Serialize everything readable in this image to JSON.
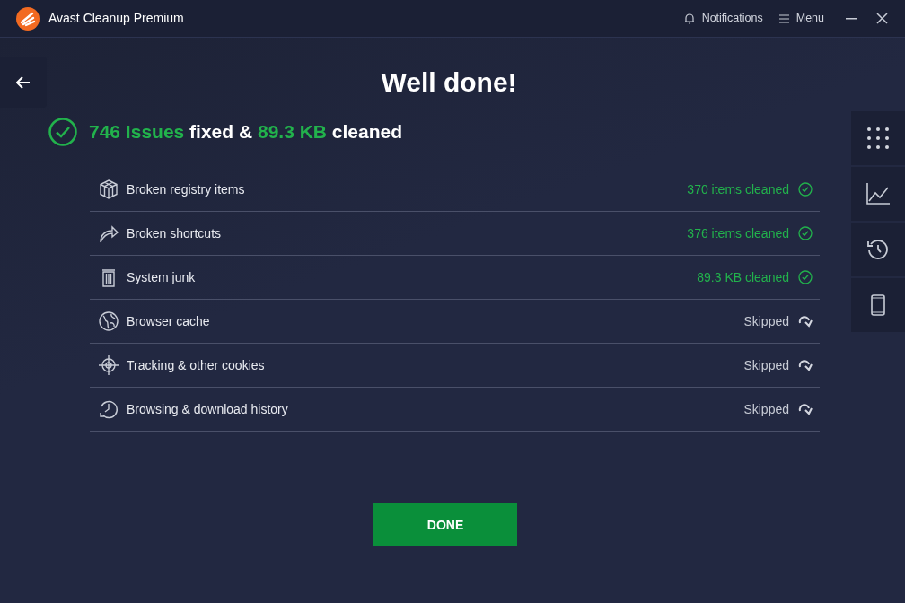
{
  "window": {
    "title": "Avast Cleanup Premium",
    "notifications": "Notifications",
    "menu": "Menu"
  },
  "heading": "Well done!",
  "summary": [
    {
      "text": "746 Issues",
      "kind": "highlight"
    },
    {
      "text": "fixed &",
      "kind": "plain"
    },
    {
      "text": "89.3 KB",
      "kind": "highlight"
    },
    {
      "text": "cleaned",
      "kind": "plain"
    }
  ],
  "results": [
    {
      "name": "Broken registry items",
      "status": "370 items cleaned",
      "kind": "cleaned"
    },
    {
      "name": "Broken shortcuts",
      "status": "376 items cleaned",
      "kind": "cleaned"
    },
    {
      "name": "System junk",
      "status": "89.3 KB cleaned",
      "kind": "cleaned"
    },
    {
      "name": "Browser cache",
      "status": "Skipped",
      "kind": "skipped"
    },
    {
      "name": "Tracking & other cookies",
      "status": "Skipped",
      "kind": "skipped"
    },
    {
      "name": "Browsing & download history",
      "status": "Skipped",
      "kind": "skipped"
    }
  ],
  "done_button": "DONE"
}
